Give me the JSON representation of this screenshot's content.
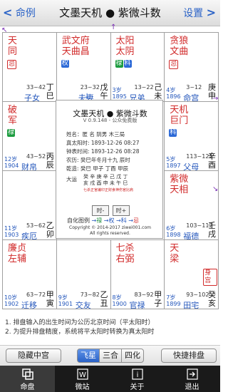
{
  "topbar": {
    "back_label": "命例",
    "title": "文墨天机 ● 紫微斗数",
    "settings_label": "设置"
  },
  "cells": {
    "si": {
      "stars": [
        {
          "t": "天",
          "c": "r"
        },
        {
          "t": "同",
          "c": "r"
        }
      ],
      "tags": [
        {
          "t": "忌",
          "s": "red"
        }
      ],
      "age_range": "33~42",
      "palace": "子女",
      "gan": "丁",
      "zhi": "巳"
    },
    "wu": {
      "stars": [
        {
          "t": "武",
          "c": "r"
        },
        {
          "t": "天",
          "c": "r"
        },
        {
          "t": "文",
          "c": "r"
        },
        {
          "t": "曲",
          "c": "r"
        },
        {
          "t": "府",
          "c": "r"
        },
        {
          "t": "昌",
          "c": "r"
        }
      ],
      "tags": [
        {
          "t": "权",
          "s": "blue"
        }
      ],
      "age_range": "23~32",
      "palace": "夫妻",
      "gan": "戊",
      "zhi": "午"
    },
    "wei": {
      "stars": [
        {
          "t": "太",
          "c": "r"
        },
        {
          "t": "太",
          "c": "r"
        },
        {
          "t": "阳",
          "c": "r"
        },
        {
          "t": "阴",
          "c": "r"
        }
      ],
      "tags": [
        {
          "t": "禄",
          "s": "green"
        },
        {
          "t": "科",
          "s": "blue"
        }
      ],
      "age_line1": "3岁",
      "age_line2": "1895",
      "age_range": "13~22",
      "palace": "兄弟",
      "gan": "己",
      "zhi": "未"
    },
    "shen": {
      "stars": [
        {
          "t": "贪",
          "c": "r"
        },
        {
          "t": "文",
          "c": "r"
        },
        {
          "t": "狼",
          "c": "r"
        },
        {
          "t": "曲",
          "c": "r"
        }
      ],
      "tags": [
        {
          "t": "忌",
          "s": "red"
        }
      ],
      "age_line1": "4岁",
      "age_line2": "1896",
      "age_range": "3~12",
      "palace": "命宫",
      "gan": "庚",
      "zhi": "申"
    },
    "chen": {
      "stars": [
        {
          "t": "破",
          "c": "r"
        },
        {
          "t": "军",
          "c": "r"
        }
      ],
      "tags": [
        {
          "t": "禄",
          "s": "green"
        }
      ],
      "age_line1": "12岁",
      "age_line2": "1904",
      "age_range": "43~52",
      "palace": "财帛",
      "gan": "丙",
      "zhi": "辰"
    },
    "you": {
      "stars": [
        {
          "t": "天",
          "c": "r"
        },
        {
          "t": "巨",
          "c": "r"
        },
        {
          "t": "机",
          "c": "r"
        },
        {
          "t": "门",
          "c": "r"
        }
      ],
      "tags": [
        {
          "t": "科",
          "s": "blue"
        }
      ],
      "age_line1": "5岁",
      "age_line2": "1897",
      "age_range": "113~122",
      "palace": "父母",
      "gan": "辛",
      "zhi": "酉"
    },
    "mao": {
      "stars": [],
      "tags": [],
      "age_line1": "11岁",
      "age_line2": "1903",
      "age_range": "53~62",
      "palace": "疾厄",
      "gan": "乙",
      "zhi": "卯"
    },
    "xu": {
      "stars": [
        {
          "t": "紫",
          "c": "r"
        },
        {
          "t": "天",
          "c": "r"
        },
        {
          "t": "微",
          "c": "r"
        },
        {
          "t": "相",
          "c": "r"
        }
      ],
      "tags": [],
      "age_line1": "6岁",
      "age_line2": "1898",
      "age_range": "103~112",
      "palace": "福德",
      "gan": "壬",
      "zhi": "戌"
    },
    "yin": {
      "stars": [
        {
          "t": "廉",
          "c": "r"
        },
        {
          "t": "左",
          "c": "r"
        },
        {
          "t": "贞",
          "c": "r"
        },
        {
          "t": "辅",
          "c": "r"
        }
      ],
      "tags": [],
      "age_line1": "10岁",
      "age_line2": "1902",
      "age_range": "63~72",
      "palace": "迁移",
      "gan": "甲",
      "zhi": "寅"
    },
    "chou": {
      "stars": [],
      "tags": [],
      "age_line1": "9岁",
      "age_line2": "1901",
      "age_range": "73~82",
      "palace": "交友",
      "gan": "乙",
      "zhi": "丑"
    },
    "zi": {
      "stars": [
        {
          "t": "七",
          "c": "r"
        },
        {
          "t": "右",
          "c": "r"
        },
        {
          "t": "杀",
          "c": "r"
        },
        {
          "t": "弼",
          "c": "r"
        }
      ],
      "tags": [],
      "age_line1": "8岁",
      "age_line2": "1900",
      "age_range": "83~92",
      "palace": "官禄",
      "gan": "甲",
      "zhi": "子"
    },
    "hai": {
      "stars": [
        {
          "t": "天",
          "c": "r"
        },
        {
          "t": "梁",
          "c": "r"
        }
      ],
      "tags": [
        {
          "t": "身宫",
          "s": "red"
        }
      ],
      "age_line1": "7岁",
      "age_line2": "1899",
      "age_range": "93~102",
      "palace": "田宅",
      "gan": "癸",
      "zhi": "亥"
    }
  },
  "center": {
    "title": "文墨天机 ● 紫微斗数",
    "version": "V 0.9.148 - 公众免费版",
    "name_line": "姓名：匿 名      阴男  木三局",
    "true_solar": "真太阳时: 1893-12-26  08:27",
    "lunar_birth": "钟表时间: 1893-12-26  08:28",
    "lunar_calendar": "农历: 癸巳年冬月十九 辰时",
    "ganzhi": "乾造: 癸巳  甲子  丁酉  甲辰",
    "dayun_label": "大运",
    "dayun_row1": "癸 辛 庚 辛 己 戊 丁",
    "dayun_row2": "亥 戌 酉 申 未 午 巳",
    "small_note": "七杀正官编印正财食神伤官比肩",
    "btn_shi_minus": "时-",
    "btn_shi_plus": "时+",
    "legend_prefix": "自化图例",
    "legend_lu": "禄",
    "legend_quan": "权",
    "legend_ke": "科",
    "legend_ji": "忌",
    "copyright1": "Copyright © 2014-2017 ziwei001.com",
    "copyright2": "All rights reserved."
  },
  "notes": [
    "1. 排盘输入的出生时间为公历北京时间（平太阳时）",
    "2. 为提升排盘精度，系统将平太阳时转换为真太阳时"
  ],
  "actions": {
    "hide_center": "隐藏中宫",
    "seg_feixing": "飞星",
    "seg_sanhe": "三合",
    "seg_sihua": "四化",
    "quick": "快捷排盘"
  },
  "tabs": [
    {
      "label": "命盘",
      "icon": "chart-icon"
    },
    {
      "label": "微站",
      "icon": "w-icon"
    },
    {
      "label": "关于",
      "icon": "info-icon"
    },
    {
      "label": "退出",
      "icon": "exit-icon"
    }
  ],
  "colors": {
    "accent": "#2b63c7",
    "red": "#d12a2a",
    "green": "#1a8c3a",
    "blue": "#2255bb"
  }
}
